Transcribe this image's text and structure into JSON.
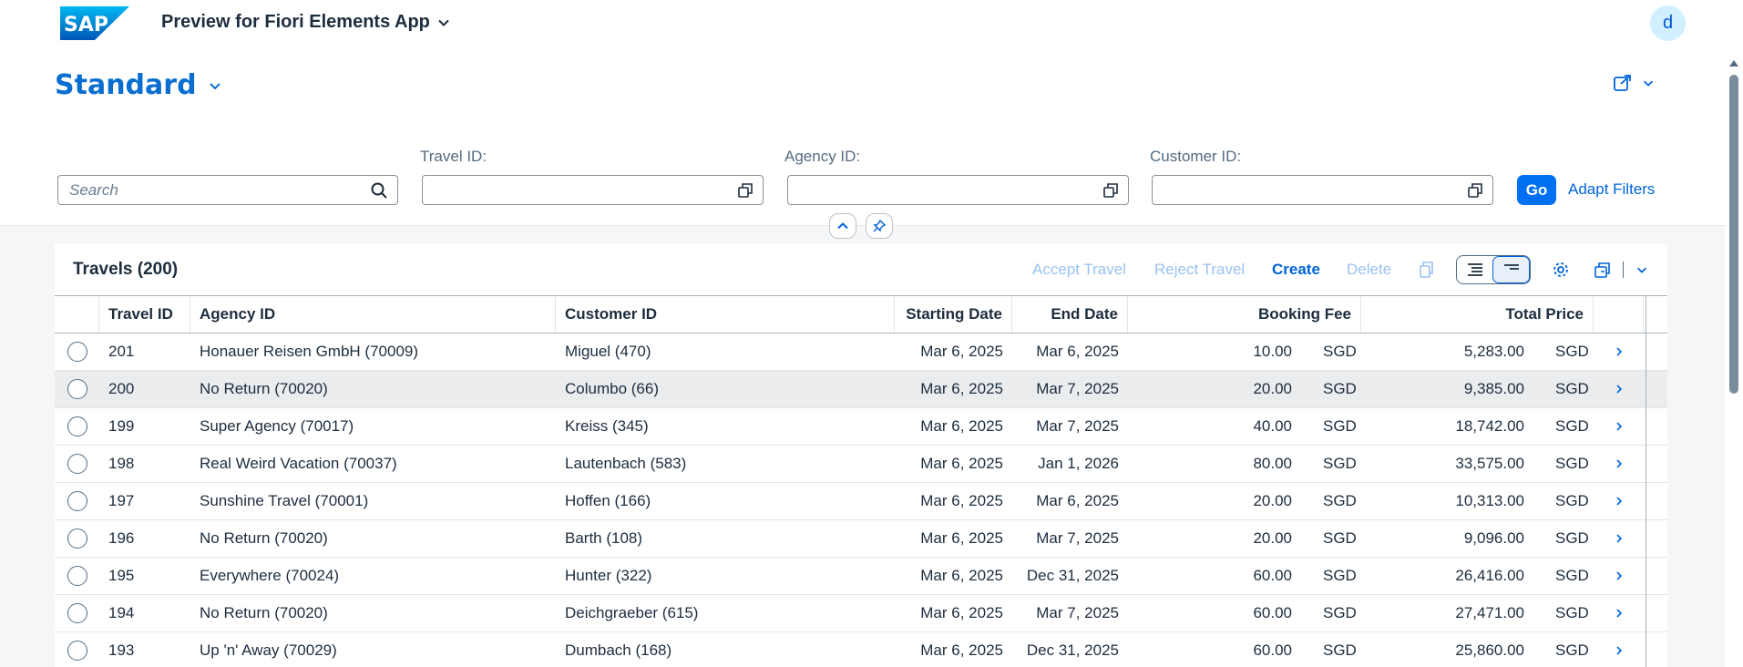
{
  "shell": {
    "logo_text": "SAP",
    "app_title": "Preview for Fiori Elements App",
    "avatar_initial": "d"
  },
  "header": {
    "variant": "Standard"
  },
  "filters": {
    "search_placeholder": "Search",
    "travel_id_label": "Travel ID:",
    "agency_id_label": "Agency ID:",
    "customer_id_label": "Customer ID:",
    "go_label": "Go",
    "adapt_label": "Adapt Filters"
  },
  "table": {
    "title": "Travels (200)",
    "actions": {
      "accept": "Accept Travel",
      "reject": "Reject Travel",
      "create": "Create",
      "delete": "Delete"
    },
    "columns": [
      "Travel ID",
      "Agency ID",
      "Customer ID",
      "Starting Date",
      "End Date",
      "Booking Fee",
      "Total Price"
    ],
    "rows": [
      {
        "id": "201",
        "agency": "Honauer Reisen GmbH (70009)",
        "customer": "Miguel (470)",
        "start": "Mar 6, 2025",
        "end": "Mar 6, 2025",
        "fee": "10.00",
        "fee_cur": "SGD",
        "total": "5,283.00",
        "total_cur": "SGD"
      },
      {
        "id": "200",
        "agency": "No Return (70020)",
        "customer": "Columbo (66)",
        "start": "Mar 6, 2025",
        "end": "Mar 7, 2025",
        "fee": "20.00",
        "fee_cur": "SGD",
        "total": "9,385.00",
        "total_cur": "SGD"
      },
      {
        "id": "199",
        "agency": "Super Agency (70017)",
        "customer": "Kreiss (345)",
        "start": "Mar 6, 2025",
        "end": "Mar 7, 2025",
        "fee": "40.00",
        "fee_cur": "SGD",
        "total": "18,742.00",
        "total_cur": "SGD"
      },
      {
        "id": "198",
        "agency": "Real Weird Vacation (70037)",
        "customer": "Lautenbach (583)",
        "start": "Mar 6, 2025",
        "end": "Jan 1, 2026",
        "fee": "80.00",
        "fee_cur": "SGD",
        "total": "33,575.00",
        "total_cur": "SGD"
      },
      {
        "id": "197",
        "agency": "Sunshine Travel (70001)",
        "customer": "Hoffen (166)",
        "start": "Mar 6, 2025",
        "end": "Mar 6, 2025",
        "fee": "20.00",
        "fee_cur": "SGD",
        "total": "10,313.00",
        "total_cur": "SGD"
      },
      {
        "id": "196",
        "agency": "No Return (70020)",
        "customer": "Barth (108)",
        "start": "Mar 6, 2025",
        "end": "Mar 7, 2025",
        "fee": "20.00",
        "fee_cur": "SGD",
        "total": "9,096.00",
        "total_cur": "SGD"
      },
      {
        "id": "195",
        "agency": "Everywhere (70024)",
        "customer": "Hunter (322)",
        "start": "Mar 6, 2025",
        "end": "Dec 31, 2025",
        "fee": "60.00",
        "fee_cur": "SGD",
        "total": "26,416.00",
        "total_cur": "SGD"
      },
      {
        "id": "194",
        "agency": "No Return (70020)",
        "customer": "Deichgraeber (615)",
        "start": "Mar 6, 2025",
        "end": "Mar 7, 2025",
        "fee": "60.00",
        "fee_cur": "SGD",
        "total": "27,471.00",
        "total_cur": "SGD"
      },
      {
        "id": "193",
        "agency": "Up 'n' Away (70029)",
        "customer": "Dumbach (168)",
        "start": "Mar 6, 2025",
        "end": "Dec 31, 2025",
        "fee": "60.00",
        "fee_cur": "SGD",
        "total": "25,860.00",
        "total_cur": "SGD"
      }
    ]
  },
  "colors": {
    "brand": "#0070f2",
    "link": "#0064d9",
    "disabled": "#9ac2f0",
    "row_hover": "#eaecee"
  },
  "icons": [
    "sap-logo",
    "chevron-down-icon",
    "share-icon",
    "search-icon",
    "value-help-icon",
    "collapse-icon",
    "pin-icon",
    "copy-icon",
    "condensed-view-icon",
    "expanded-view-icon",
    "settings-icon",
    "export-icon",
    "nav-arrow-icon"
  ]
}
